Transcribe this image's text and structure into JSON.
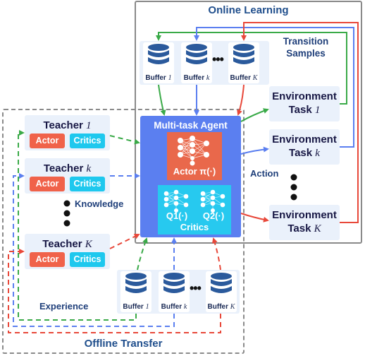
{
  "online": {
    "title": "Online Learning",
    "transition_label_1": "Transition",
    "transition_label_2": "Samples",
    "buffers": [
      {
        "prefix": "Buffer ",
        "index": "1"
      },
      {
        "prefix": "Buffer ",
        "index": "k"
      },
      {
        "prefix": "Buffer ",
        "index": "K"
      }
    ],
    "environments": [
      {
        "title": "Environment",
        "task_prefix": "Task ",
        "index": "1"
      },
      {
        "title": "Environment",
        "task_prefix": "Task ",
        "index": "k"
      },
      {
        "title": "Environment",
        "task_prefix": "Task ",
        "index": "K"
      }
    ],
    "action_label": "Action"
  },
  "agent": {
    "title": "Multi-task Agent",
    "actor_label": "Actor π(·)",
    "q1_label": "Q1(·)",
    "q2_label": "Q2(·)",
    "critics_label": "Critics"
  },
  "offline": {
    "title": "Offline Transfer",
    "knowledge_label": "Knowledge",
    "experience_label": "Experience",
    "teachers": [
      {
        "prefix": "Teacher ",
        "index": "1",
        "actor": "Actor",
        "critics": "Critics"
      },
      {
        "prefix": "Teacher ",
        "index": "k",
        "actor": "Actor",
        "critics": "Critics"
      },
      {
        "prefix": "Teacher ",
        "index": "K",
        "actor": "Actor",
        "critics": "Critics"
      }
    ],
    "buffers": [
      {
        "prefix": "Buffer ",
        "index": "1"
      },
      {
        "prefix": "Buffer ",
        "index": "k"
      },
      {
        "prefix": "Buffer ",
        "index": "K"
      }
    ]
  },
  "ellipsis": "•••",
  "colors": {
    "task_1": "#3aaa48",
    "task_k": "#5b7ff0",
    "task_K": "#e8483a",
    "agent": "#5b7ff0",
    "actor": "#e9684b",
    "critic": "#27c9ef",
    "database": "#2b5a9c",
    "panel": "#eaf1fb",
    "frame": "#8a8a8a"
  }
}
